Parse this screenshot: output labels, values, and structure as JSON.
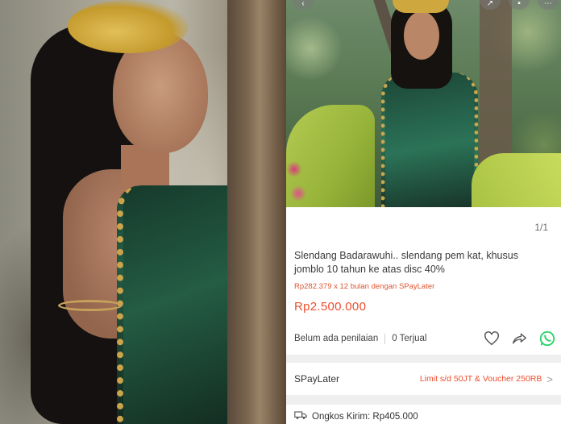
{
  "left_photo": {
    "description_icon": "portrait-photo"
  },
  "product": {
    "image_counter": "1/1",
    "title": "Slendang Badarawuhi.. slendang pem kat, khusus jomblo 10 tahun ke atas disc 40%",
    "paylater_line": "Rp282.379 x 12 bulan dengan SPayLater",
    "price": "Rp2.500.000",
    "rating_text": "Belum ada penilaian",
    "sold_text": "0 Terjual"
  },
  "paylater": {
    "label": "SPayLater",
    "offer": "Limit s/d 50JT & Voucher 250RB",
    "chevron": ">"
  },
  "shipping": {
    "label": "Ongkos Kirim: Rp405.000"
  },
  "icons": {
    "heart": "heart-icon",
    "share": "share-icon",
    "whatsapp": "whatsapp-icon",
    "truck": "truck-icon"
  },
  "colors": {
    "accent": "#ee4d2d",
    "whatsapp": "#25d366",
    "text": "#3a3a3a"
  }
}
